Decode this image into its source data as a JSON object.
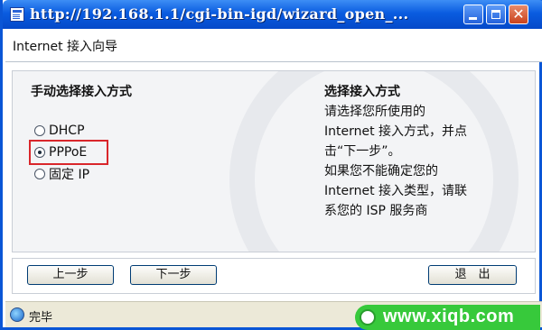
{
  "window": {
    "title": "http://192.168.1.1/cgi-bin-igd/wizard_open_...",
    "controls": {
      "minimize": "minimize",
      "maximize": "maximize",
      "close": "✕"
    }
  },
  "header": {
    "title": "Internet 接入向导"
  },
  "left": {
    "heading": "手动选择接入方式",
    "options": [
      {
        "label": "DHCP",
        "checked": false
      },
      {
        "label": "PPPoE",
        "checked": true
      },
      {
        "label": "固定 IP",
        "checked": false
      }
    ]
  },
  "right": {
    "heading": "选择接入方式",
    "lines": [
      "请选择您所使用的",
      "Internet 接入方式，并点",
      "击“下一步”。",
      "如果您不能确定您的",
      "Internet 接入类型，请联",
      "系您的 ISP 服务商"
    ]
  },
  "buttons": {
    "prev": "上一步",
    "next": "下一步",
    "exit": "退　出"
  },
  "status": {
    "text": "完毕"
  },
  "watermark": {
    "text": "www.xiqb.com"
  },
  "colors": {
    "titlebar": "#0a5ce0",
    "highlight": "#d9262b",
    "watermark": "#37c93b"
  }
}
